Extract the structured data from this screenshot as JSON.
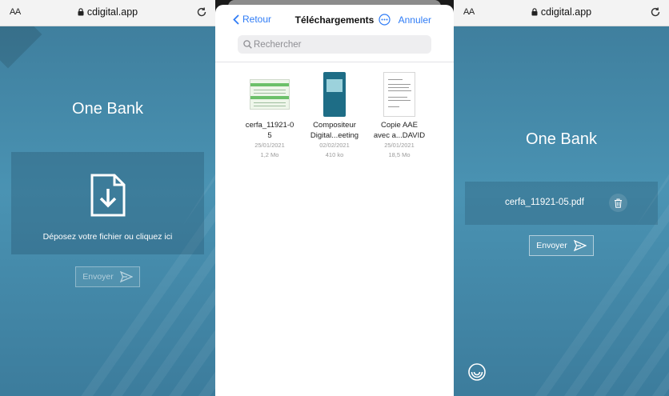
{
  "browser": {
    "aa_label": "AA",
    "url": "cdigital.app"
  },
  "app": {
    "brand": "One Bank",
    "drop_text": "Déposez votre fichier ou cliquez ici",
    "send_label": "Envoyer"
  },
  "picker": {
    "back_label": "Retour",
    "title": "Téléchargements",
    "cancel_label": "Annuler",
    "search_placeholder": "Rechercher",
    "files": [
      {
        "name_line1": "cerfa_11921-0",
        "name_line2": "5",
        "date": "25/01/2021",
        "size": "1,2 Mo"
      },
      {
        "name_line1": "Compositeur",
        "name_line2": "Digital...eeting",
        "date": "02/02/2021",
        "size": "410 ko"
      },
      {
        "name_line1": "Copie AAE",
        "name_line2": "avec a...DAVID",
        "date": "25/01/2021",
        "size": "18,5 Mo"
      }
    ]
  },
  "uploaded": {
    "file_name": "cerfa_11921-05.pdf"
  },
  "icons": [
    "lock-icon",
    "reload-icon",
    "download-file-icon",
    "send-icon",
    "chevron-left-icon",
    "more-icon",
    "search-icon",
    "trash-icon",
    "app-logo-icon"
  ],
  "colors": {
    "accent_blue": "#2f7cf6",
    "app_teal": "#4a93b3"
  }
}
